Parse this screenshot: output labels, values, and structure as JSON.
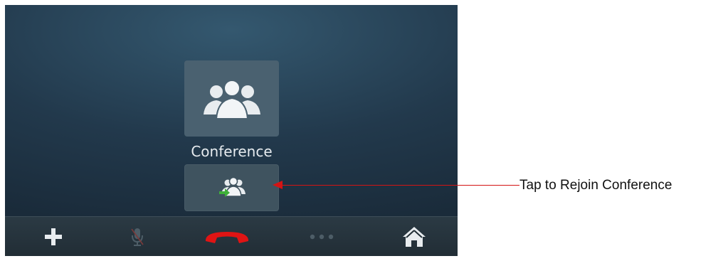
{
  "conference": {
    "label": "Conference",
    "icon": "group-icon",
    "rejoin_icon": "rejoin-conference-icon"
  },
  "bottom_bar": {
    "items": [
      {
        "icon": "plus-icon"
      },
      {
        "icon": "mute-microphone-icon"
      },
      {
        "icon": "end-call-icon"
      },
      {
        "icon": "more-dots-icon"
      },
      {
        "icon": "home-icon"
      }
    ]
  },
  "annotation": {
    "text": "Tap to Rejoin Conference",
    "color": "#d41414"
  },
  "colors": {
    "end_call": "#e01414",
    "rejoin_arrow": "#3fb03a",
    "icon_white": "#e8ecef"
  }
}
